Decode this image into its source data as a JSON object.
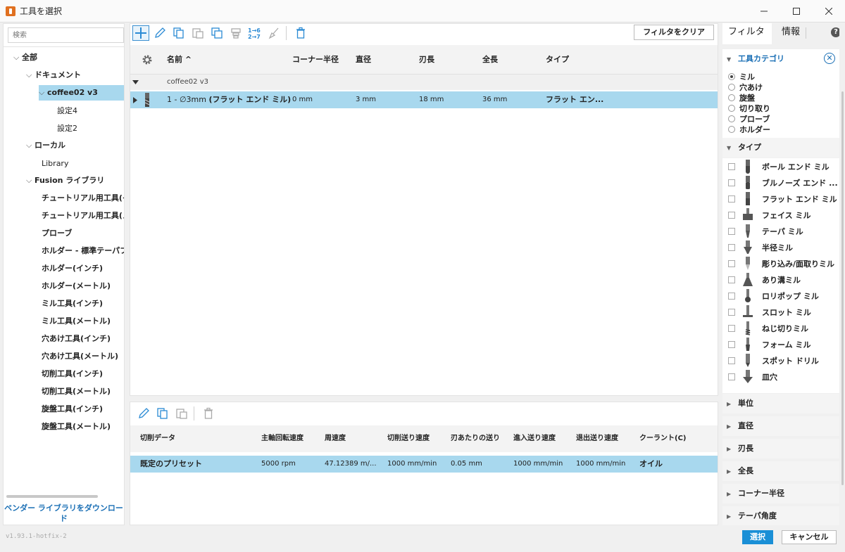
{
  "window": {
    "title": "工具を選択"
  },
  "search": {
    "placeholder": "検索"
  },
  "tree": {
    "all": "全部",
    "document": "ドキュメント",
    "doc_name": "coffee02 v3",
    "setup4": "設定4",
    "setup2": "設定2",
    "local": "ローカル",
    "library": "Library",
    "fusion": "Fusion ライブラリ",
    "fusion_items": [
      "チュートリアル用工具(イ",
      "チュートリアル用工具(メ",
      "プローブ",
      "ホルダー - 標準テーパフ",
      "ホルダー(インチ)",
      "ホルダー(メートル)",
      "ミル工具(インチ)",
      "ミル工具(メートル)",
      "穴あけ工具(インチ)",
      "穴あけ工具(メートル)",
      "切削工具(インチ)",
      "切削工具(メートル)",
      "旋盤工具(インチ)",
      "旋盤工具(メートル)"
    ],
    "vendor_link": "ベンダー ライブラリをダウンロード"
  },
  "version": "v1.93.1-hotfix-2",
  "toolbar": {
    "clear_filter": "フィルタをクリア",
    "numbering_top": "1→6",
    "numbering_bottom": "2→7"
  },
  "grid": {
    "headers": [
      "名前 ^",
      "コーナー半径",
      "直径",
      "刃長",
      "全長",
      "タイプ"
    ],
    "group": "coffee02 v3",
    "row": {
      "name_prefix": "1 - ∅3mm",
      "name_bold": "(フラット エンド ミル)",
      "corner_radius": "0 mm",
      "diameter": "3 mm",
      "flute_length": "18 mm",
      "overall_length": "36 mm",
      "type": "フラット エン..."
    }
  },
  "presets": {
    "headers": [
      "切削データ",
      "主軸回転速度",
      "周速度",
      "切削送り速度",
      "刃あたりの送り",
      "進入送り速度",
      "退出送り速度",
      "クーラント(C)"
    ],
    "row": [
      "既定のプリセット",
      "5000 rpm",
      "47.12389 m/...",
      "1000 mm/min",
      "0.05 mm",
      "1000 mm/min",
      "1000 mm/min",
      "オイル"
    ]
  },
  "filters": {
    "tabs": [
      "フィルタ",
      "情報"
    ],
    "category_title": "工具カテゴリ",
    "categories": [
      "ミル",
      "穴あけ",
      "旋盤",
      "切り取り",
      "プローブ",
      "ホルダー"
    ],
    "selected_category": "ミル",
    "type_title": "タイプ",
    "types": [
      "ボール エンド ミル",
      "ブルノーズ エンド ...",
      "フラット エンド ミル",
      "フェイス ミル",
      "テーパ ミル",
      "半径ミル",
      "彫り込み/面取りミル",
      "あり溝ミル",
      "ロリポップ ミル",
      "スロット ミル",
      "ねじ切りミル",
      "フォーム ミル",
      "スポット ドリル",
      "皿穴"
    ],
    "collapsed_sections": [
      "単位",
      "直径",
      "刃長",
      "全長",
      "コーナー半径",
      "テーパ角度"
    ]
  },
  "buttons": {
    "select": "選択",
    "cancel": "キャンセル"
  },
  "colors": {
    "accent": "#1a8fd6",
    "selection": "#a8d8ee",
    "link": "#1a6fb5"
  }
}
